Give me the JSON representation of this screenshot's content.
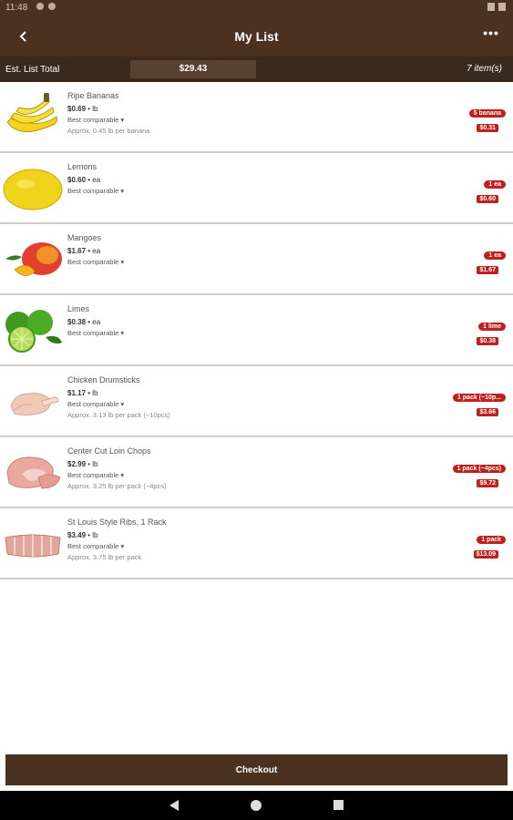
{
  "status_bar": {
    "time": "11:48"
  },
  "app_bar": {
    "title": "My List",
    "more_label": "•••"
  },
  "summary": {
    "label": "Est. List Total",
    "total": "$29.43",
    "count": "7 item(s)"
  },
  "items": [
    {
      "name": "Ripe Bananas",
      "price": "$0.69",
      "unit": " • lb",
      "comparable": "Best comparable ▾",
      "approx": "Approx. 0.45 lb per banana",
      "qty": "5 banana",
      "line_price": "$0.31"
    },
    {
      "name": "Lemons",
      "price": "$0.60",
      "unit": " • ea",
      "comparable": "Best comparable ▾",
      "approx": "",
      "qty": "1 ea",
      "line_price": "$0.60"
    },
    {
      "name": "Mangoes",
      "price": "$1.67",
      "unit": " • ea",
      "comparable": "Best comparable ▾",
      "approx": "",
      "qty": "1 ea",
      "line_price": "$1.67"
    },
    {
      "name": "Limes",
      "price": "$0.38",
      "unit": " • ea",
      "comparable": "Best comparable ▾",
      "approx": "",
      "qty": "1 lime",
      "line_price": "$0.38"
    },
    {
      "name": "Chicken Drumsticks",
      "price": "$1.17",
      "unit": " • lb",
      "comparable": "Best comparable ▾",
      "approx": "Approx. 3.13 lb per pack (~10pcs)",
      "qty": "1 pack (~10p...",
      "line_price": "$3.66"
    },
    {
      "name": "Center Cut Loin Chops",
      "price": "$2.99",
      "unit": " • lb",
      "comparable": "Best comparable ▾",
      "approx": "Approx. 3.25 lb per pack (~4pcs)",
      "qty": "1 pack (~4pcs)",
      "line_price": "$9.72"
    },
    {
      "name": "St Louis Style Ribs, 1 Rack",
      "price": "$3.49",
      "unit": " • lb",
      "comparable": "Best comparable ▾",
      "approx": "Approx. 3.75 lb per pack",
      "qty": "1 pack",
      "line_price": "$13.09"
    }
  ],
  "checkout_label": "Checkout"
}
